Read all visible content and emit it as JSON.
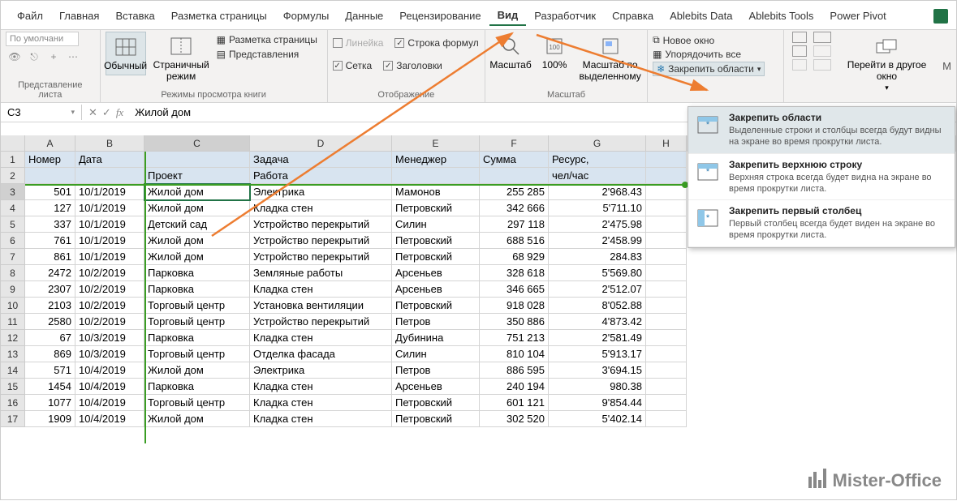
{
  "tabs": [
    "Файл",
    "Главная",
    "Вставка",
    "Разметка страницы",
    "Формулы",
    "Данные",
    "Рецензирование",
    "Вид",
    "Разработчик",
    "Справка",
    "Ablebits Data",
    "Ablebits Tools",
    "Power Pivot"
  ],
  "active_tab": "Вид",
  "ribbon": {
    "group1_label": "Представление листа",
    "combo_default": "По умолчани",
    "group2_label": "Режимы просмотра книги",
    "normal": "Обычный",
    "page_break": "Страничный режим",
    "page_layout": "Разметка страницы",
    "custom_views": "Представления",
    "group3_label": "Отображение",
    "ruler": "Линейка",
    "formula_bar": "Строка формул",
    "gridlines": "Сетка",
    "headings": "Заголовки",
    "group4_label": "Масштаб",
    "zoom": "Масштаб",
    "zoom100": "100%",
    "zoom_sel": "Масштаб по выделенному",
    "new_window": "Новое окно",
    "arrange": "Упорядочить все",
    "freeze": "Закрепить области",
    "switch": "Перейти в другое окно"
  },
  "freeze_menu": [
    {
      "title": "Закрепить области",
      "desc": "Выделенные строки и столбцы всегда будут видны на экране во время прокрутки листа."
    },
    {
      "title": "Закрепить верхнюю строку",
      "desc": "Верхняя строка всегда будет видна на экране во время прокрутки листа."
    },
    {
      "title": "Закрепить первый столбец",
      "desc": "Первый столбец всегда будет виден на экране во время прокрутки листа."
    }
  ],
  "name_box": "C3",
  "formula": "Жилой дом",
  "columns": [
    "A",
    "B",
    "C",
    "D",
    "E",
    "F",
    "G",
    "H"
  ],
  "header_row1": {
    "A": "Номер",
    "B": "Дата",
    "C": "",
    "D": "Задача",
    "E": "Менеджер",
    "F": "Сумма",
    "G": "Ресурс,",
    "H": ""
  },
  "header_row2": {
    "A": "",
    "B": "",
    "C": "Проект",
    "D": "Работа",
    "E": "",
    "F": "",
    "G": "чел/час",
    "H": ""
  },
  "rows": [
    {
      "n": 3,
      "A": "501",
      "B": "10/1/2019",
      "C": "Жилой дом",
      "D": "Электрика",
      "E": "Мамонов",
      "F": "255 285",
      "G": "2'968.43"
    },
    {
      "n": 4,
      "A": "127",
      "B": "10/1/2019",
      "C": "Жилой дом",
      "D": "Кладка стен",
      "E": "Петровский",
      "F": "342 666",
      "G": "5'711.10"
    },
    {
      "n": 5,
      "A": "337",
      "B": "10/1/2019",
      "C": "Детский сад",
      "D": "Устройство перекрытий",
      "E": "Силин",
      "F": "297 118",
      "G": "2'475.98"
    },
    {
      "n": 6,
      "A": "761",
      "B": "10/1/2019",
      "C": "Жилой дом",
      "D": "Устройство перекрытий",
      "E": "Петровский",
      "F": "688 516",
      "G": "2'458.99"
    },
    {
      "n": 7,
      "A": "861",
      "B": "10/1/2019",
      "C": "Жилой дом",
      "D": "Устройство перекрытий",
      "E": "Петровский",
      "F": "68 929",
      "G": "284.83"
    },
    {
      "n": 8,
      "A": "2472",
      "B": "10/2/2019",
      "C": "Парковка",
      "D": "Земляные работы",
      "E": "Арсеньев",
      "F": "328 618",
      "G": "5'569.80"
    },
    {
      "n": 9,
      "A": "2307",
      "B": "10/2/2019",
      "C": "Парковка",
      "D": "Кладка стен",
      "E": "Арсеньев",
      "F": "346 665",
      "G": "2'512.07"
    },
    {
      "n": 10,
      "A": "2103",
      "B": "10/2/2019",
      "C": "Торговый центр",
      "D": "Установка вентиляции",
      "E": "Петровский",
      "F": "918 028",
      "G": "8'052.88"
    },
    {
      "n": 11,
      "A": "2580",
      "B": "10/2/2019",
      "C": "Торговый центр",
      "D": "Устройство перекрытий",
      "E": "Петров",
      "F": "350 886",
      "G": "4'873.42"
    },
    {
      "n": 12,
      "A": "67",
      "B": "10/3/2019",
      "C": "Парковка",
      "D": "Кладка стен",
      "E": "Дубинина",
      "F": "751 213",
      "G": "2'581.49"
    },
    {
      "n": 13,
      "A": "869",
      "B": "10/3/2019",
      "C": "Торговый центр",
      "D": "Отделка фасада",
      "E": "Силин",
      "F": "810 104",
      "G": "5'913.17"
    },
    {
      "n": 14,
      "A": "571",
      "B": "10/4/2019",
      "C": "Жилой дом",
      "D": "Электрика",
      "E": "Петров",
      "F": "886 595",
      "G": "3'694.15"
    },
    {
      "n": 15,
      "A": "1454",
      "B": "10/4/2019",
      "C": "Парковка",
      "D": "Кладка стен",
      "E": "Арсеньев",
      "F": "240 194",
      "G": "980.38"
    },
    {
      "n": 16,
      "A": "1077",
      "B": "10/4/2019",
      "C": "Торговый центр",
      "D": "Кладка стен",
      "E": "Петровский",
      "F": "601 121",
      "G": "9'854.44"
    },
    {
      "n": 17,
      "A": "1909",
      "B": "10/4/2019",
      "C": "Жилой дом",
      "D": "Кладка стен",
      "E": "Петровский",
      "F": "302 520",
      "G": "5'402.14"
    }
  ],
  "watermark": "Mister-Office"
}
